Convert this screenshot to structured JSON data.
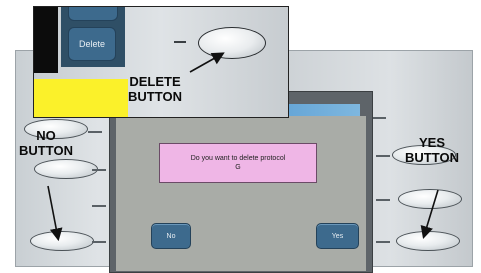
{
  "dialog": {
    "message": "Do you want to delete protocol\nG"
  },
  "buttons": {
    "no": "No",
    "yes": "Yes",
    "delete": "Delete"
  },
  "callouts": {
    "delete_button": "DELETE\nBUTTON",
    "no_button": "NO\nBUTTON",
    "yes_button": "YES\nBUTTON"
  },
  "colors": {
    "dialog_bg": "#efb6e6",
    "soft_button": "#3d6a8d",
    "inset_yellow": "#fbf12a",
    "screen_bg": "#a9aca7"
  }
}
